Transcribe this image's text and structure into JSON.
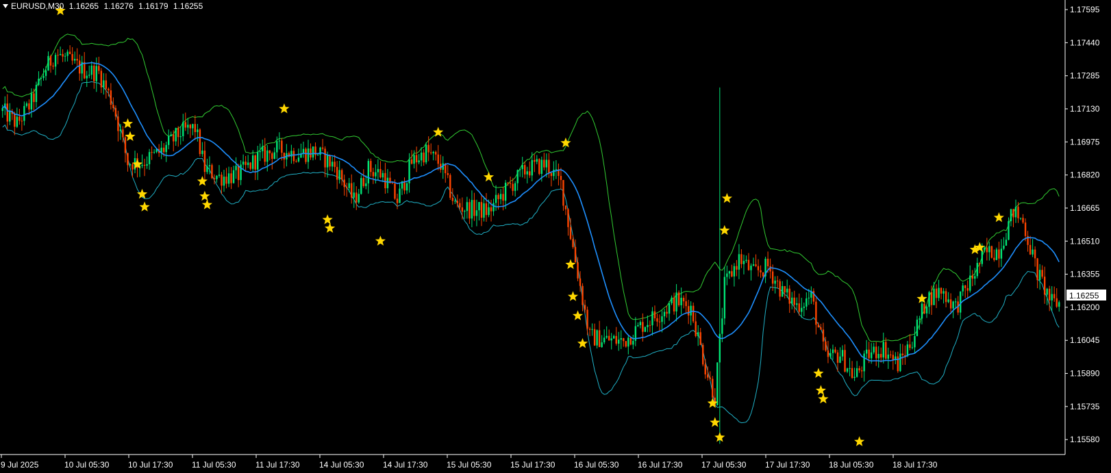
{
  "header": {
    "symbol": "EURUSD,M30",
    "open": "1.16265",
    "high": "1.16276",
    "low": "1.16179",
    "close": "1.16255"
  },
  "chart_data": {
    "type": "candlestick",
    "ylim": [
      1.1551,
      1.1764
    ],
    "y_ticks": [
      "1.17595",
      "1.17440",
      "1.17285",
      "1.17130",
      "1.16975",
      "1.16820",
      "1.16665",
      "1.16510",
      "1.16355",
      "1.16200",
      "1.16045",
      "1.15890",
      "1.15735",
      "1.15580"
    ],
    "current_price_label": "1.16255",
    "x_ticks": [
      "9 Jul 2025",
      "10 Jul 05:30",
      "10 Jul 17:30",
      "11 Jul 05:30",
      "11 Jul 17:30",
      "14 Jul 05:30",
      "14 Jul 17:30",
      "15 Jul 05:30",
      "15 Jul 17:30",
      "16 Jul 05:30",
      "16 Jul 17:30",
      "17 Jul 05:30",
      "17 Jul 17:30",
      "18 Jul 05:30",
      "18 Jul 17:30"
    ],
    "trend_path": [
      [
        0,
        1.1712
      ],
      [
        6,
        1.1706
      ],
      [
        12,
        1.1716
      ],
      [
        18,
        1.1732
      ],
      [
        22,
        1.1739
      ],
      [
        28,
        1.1735
      ],
      [
        34,
        1.1731
      ],
      [
        40,
        1.173
      ],
      [
        46,
        1.1715
      ],
      [
        52,
        1.1688
      ],
      [
        58,
        1.1688
      ],
      [
        66,
        1.1693
      ],
      [
        74,
        1.1702
      ],
      [
        80,
        1.1704
      ],
      [
        84,
        1.1685
      ],
      [
        90,
        1.1681
      ],
      [
        98,
        1.1682
      ],
      [
        106,
        1.169
      ],
      [
        114,
        1.1694
      ],
      [
        122,
        1.1692
      ],
      [
        130,
        1.1693
      ],
      [
        138,
        1.1686
      ],
      [
        146,
        1.167
      ],
      [
        152,
        1.1685
      ],
      [
        158,
        1.1682
      ],
      [
        164,
        1.167
      ],
      [
        170,
        1.1688
      ],
      [
        176,
        1.1693
      ],
      [
        182,
        1.1687
      ],
      [
        188,
        1.1668
      ],
      [
        194,
        1.1666
      ],
      [
        202,
        1.1665
      ],
      [
        210,
        1.1676
      ],
      [
        218,
        1.1685
      ],
      [
        226,
        1.1687
      ],
      [
        232,
        1.1678
      ],
      [
        238,
        1.1642
      ],
      [
        244,
        1.1606
      ],
      [
        250,
        1.1605
      ],
      [
        258,
        1.1604
      ],
      [
        266,
        1.1612
      ],
      [
        274,
        1.1618
      ],
      [
        280,
        1.1623
      ],
      [
        286,
        1.162
      ],
      [
        292,
        1.1592
      ],
      [
        296,
        1.1578
      ],
      [
        300,
        1.163
      ],
      [
        306,
        1.1643
      ],
      [
        312,
        1.1636
      ],
      [
        318,
        1.1639
      ],
      [
        324,
        1.1627
      ],
      [
        330,
        1.1621
      ],
      [
        336,
        1.1625
      ],
      [
        342,
        1.1596
      ],
      [
        348,
        1.1598
      ],
      [
        354,
        1.1587
      ],
      [
        360,
        1.1598
      ],
      [
        366,
        1.1601
      ],
      [
        372,
        1.1593
      ],
      [
        378,
        1.1605
      ],
      [
        384,
        1.1624
      ],
      [
        390,
        1.1628
      ],
      [
        396,
        1.162
      ],
      [
        402,
        1.1632
      ],
      [
        408,
        1.1645
      ],
      [
        414,
        1.1647
      ],
      [
        420,
        1.1665
      ],
      [
        424,
        1.166
      ],
      [
        430,
        1.1636
      ],
      [
        436,
        1.1622
      ]
    ],
    "spikes": [
      {
        "i": 298,
        "high": 1.1723,
        "low": 1.1556
      }
    ],
    "signal_stars": [
      {
        "i": 24,
        "price": 1.1759
      },
      {
        "i": 52,
        "price": 1.1706
      },
      {
        "i": 53,
        "price": 1.17
      },
      {
        "i": 56,
        "price": 1.1687
      },
      {
        "i": 58,
        "price": 1.1673
      },
      {
        "i": 59,
        "price": 1.1667
      },
      {
        "i": 83,
        "price": 1.1679
      },
      {
        "i": 84,
        "price": 1.1672
      },
      {
        "i": 85,
        "price": 1.1668
      },
      {
        "i": 117,
        "price": 1.1713
      },
      {
        "i": 135,
        "price": 1.1661
      },
      {
        "i": 136,
        "price": 1.1657
      },
      {
        "i": 157,
        "price": 1.1651
      },
      {
        "i": 181,
        "price": 1.1702
      },
      {
        "i": 202,
        "price": 1.1681
      },
      {
        "i": 234,
        "price": 1.1697
      },
      {
        "i": 236,
        "price": 1.164
      },
      {
        "i": 237,
        "price": 1.1625
      },
      {
        "i": 239,
        "price": 1.1616
      },
      {
        "i": 241,
        "price": 1.1603
      },
      {
        "i": 295,
        "price": 1.1575
      },
      {
        "i": 296,
        "price": 1.1566
      },
      {
        "i": 298,
        "price": 1.1559
      },
      {
        "i": 300,
        "price": 1.1656
      },
      {
        "i": 301,
        "price": 1.1671
      },
      {
        "i": 339,
        "price": 1.1589
      },
      {
        "i": 340,
        "price": 1.1581
      },
      {
        "i": 341,
        "price": 1.1577
      },
      {
        "i": 356,
        "price": 1.1557
      },
      {
        "i": 382,
        "price": 1.1624
      },
      {
        "i": 404,
        "price": 1.1647
      },
      {
        "i": 406,
        "price": 1.1648
      },
      {
        "i": 414,
        "price": 1.1662
      }
    ],
    "colors": {
      "background": "#000000",
      "bull_candle": "#00e676",
      "bear_candle": "#ff4500",
      "ma_line": "#1e90ff",
      "upper_band": "#32cd32",
      "lower_band": "#20b2c8",
      "star": "#ffd700",
      "axis": "#ffffff",
      "price_label_bg": "#ffffff",
      "price_label_text": "#000000"
    }
  }
}
